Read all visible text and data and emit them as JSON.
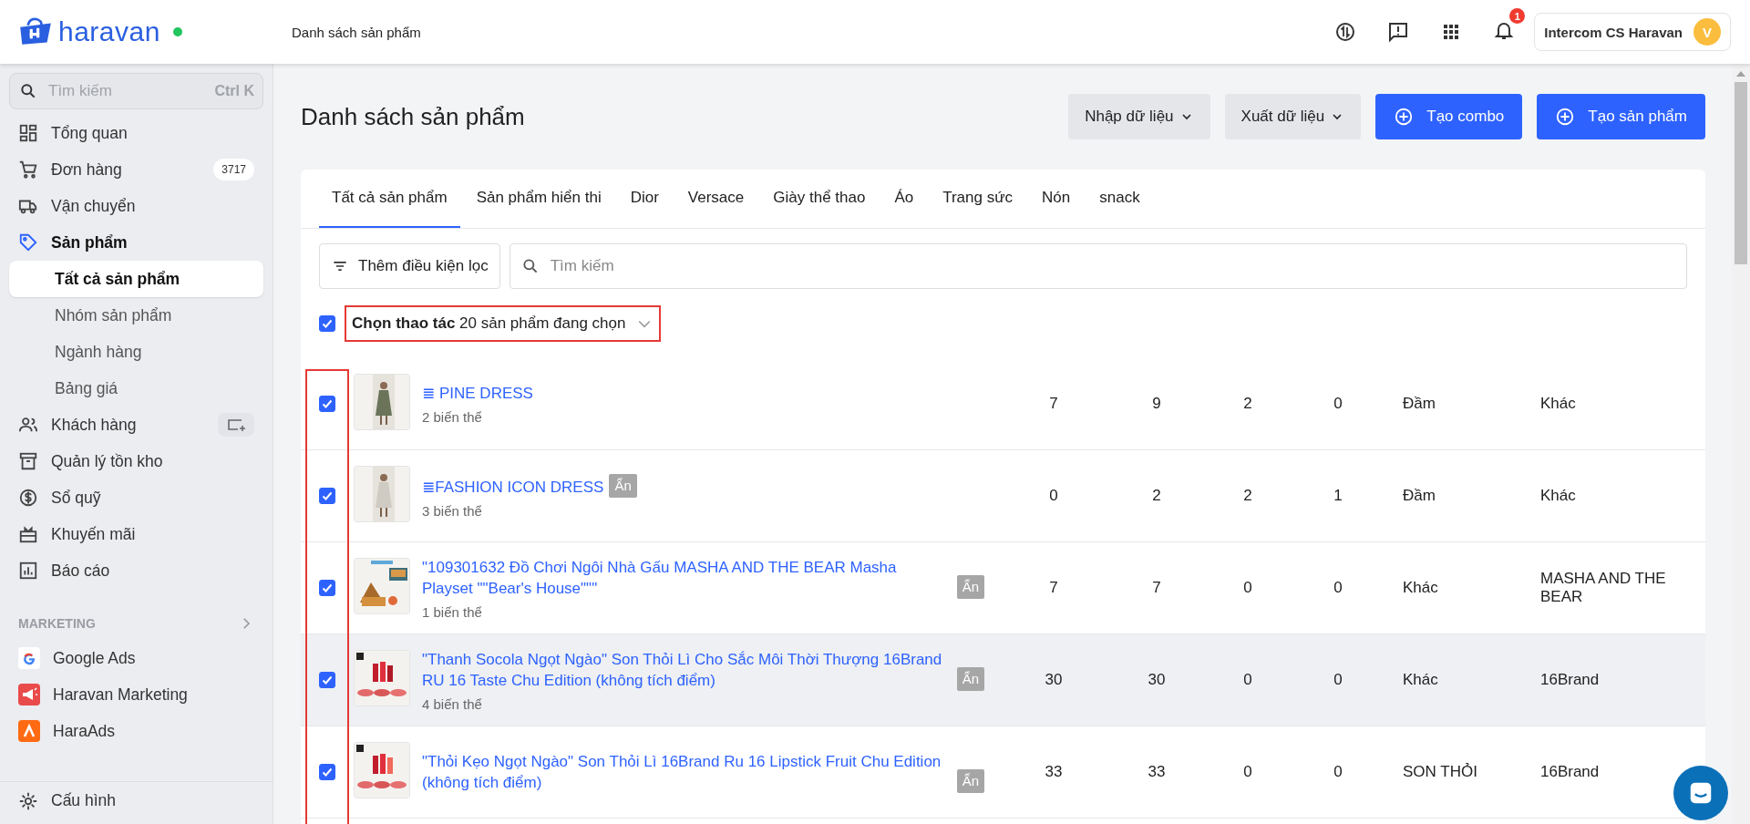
{
  "header": {
    "logo": "haravan",
    "breadcrumb": "Danh sách sản phẩm",
    "notification_count": "1",
    "user": {
      "name": "Intercom CS Haravan",
      "avatar": "V"
    }
  },
  "sidebar": {
    "search": {
      "placeholder": "Tìm kiếm",
      "shortcut": "Ctrl K"
    },
    "items": [
      {
        "label": "Tổng quan",
        "selected": false
      },
      {
        "label": "Đơn hàng",
        "selected": false,
        "badge": "3717"
      },
      {
        "label": "Vận chuyển",
        "selected": false
      },
      {
        "label": "Sản phẩm",
        "selected": true,
        "expanded": true,
        "children": [
          {
            "label": "Tất cả sản phẩm",
            "selected": true
          },
          {
            "label": "Nhóm sản phẩm",
            "selected": false
          },
          {
            "label": "Ngành hàng",
            "selected": false
          },
          {
            "label": "Bảng giá",
            "selected": false
          }
        ]
      },
      {
        "label": "Khách hàng",
        "selected": false,
        "action": true
      },
      {
        "label": "Quản lý tồn kho",
        "selected": false
      },
      {
        "label": "Sổ quỹ",
        "selected": false
      },
      {
        "label": "Khuyến mãi",
        "selected": false
      },
      {
        "label": "Báo cáo",
        "selected": false
      }
    ],
    "section": {
      "title": "MARKETING",
      "items": [
        {
          "label": "Google Ads"
        },
        {
          "label": "Haravan Marketing"
        },
        {
          "label": "HaraAds"
        }
      ]
    },
    "bottom_item": {
      "label": "Cấu hình"
    }
  },
  "page": {
    "title": "Danh sách sản phẩm",
    "buttons": [
      {
        "label": "Nhập dữ liệu",
        "kind": "menu"
      },
      {
        "label": "Xuất dữ liệu",
        "kind": "menu"
      },
      {
        "label": "Tạo combo",
        "kind": "primary"
      },
      {
        "label": "Tạo sản phẩm",
        "kind": "primary"
      }
    ]
  },
  "tabs": [
    {
      "label": "Tất cả sản phẩm",
      "selected": true
    },
    {
      "label": "Sản phẩm hiển thi",
      "selected": false
    },
    {
      "label": "Dior",
      "selected": false
    },
    {
      "label": "Versace",
      "selected": false
    },
    {
      "label": "Giày thể thao",
      "selected": false
    },
    {
      "label": "Áo",
      "selected": false
    },
    {
      "label": "Trang sức",
      "selected": false
    },
    {
      "label": "Nón",
      "selected": false
    },
    {
      "label": "snack",
      "selected": false
    }
  ],
  "filter": {
    "button": "Thêm điều kiện lọc",
    "search_placeholder": "Tìm kiếm"
  },
  "bulk": {
    "checked": true,
    "label": "Chọn thao tác",
    "count": "20 sản phẩm đang chọn",
    "highlighted": true
  },
  "table": {
    "checkbox_column_highlighted": true,
    "rows": [
      {
        "checked": true,
        "hovered": false,
        "title": "≣ PINE DRESS",
        "variants": "2 biến thể",
        "cells": [
          "7",
          "9",
          "2",
          "0",
          "Đầm",
          "Khác"
        ]
      },
      {
        "checked": true,
        "hovered": false,
        "title": "≣FASHION ICON DRESS",
        "badge": "Ẩn",
        "variants": "3 biến thể",
        "cells": [
          "0",
          "2",
          "2",
          "1",
          "Đầm",
          "Khác"
        ]
      },
      {
        "checked": true,
        "hovered": false,
        "title": "\"109301632 Đồ Chơi Ngôi Nhà Gấu MASHA AND THE BEAR Masha Playset \"\"Bear's House\"\"\"",
        "badge": "Ẩn",
        "variants": "1 biến thể",
        "cells": [
          "7",
          "7",
          "0",
          "0",
          "Khác",
          "MASHA AND THE BEAR"
        ]
      },
      {
        "checked": true,
        "hovered": true,
        "title": "\"Thanh Socola Ngọt Ngào\" Son Thỏi Lì Cho Sắc Môi Thời Thượng 16Brand RU 16 Taste Chu Edition (không tích điểm)",
        "badge": "Ẩn",
        "variants": "4 biến thể",
        "cells": [
          "30",
          "30",
          "0",
          "0",
          "Khác",
          "16Brand"
        ]
      },
      {
        "checked": true,
        "hovered": false,
        "title": "\"Thỏi Kẹo Ngọt Ngào\" Son Thỏi Lì 16Brand Ru 16 Lipstick Fruit Chu Edition (không tích điểm)",
        "badge": "Ẩn",
        "cells": [
          "33",
          "33",
          "0",
          "0",
          "SON THỎI",
          "16Brand"
        ]
      }
    ]
  }
}
